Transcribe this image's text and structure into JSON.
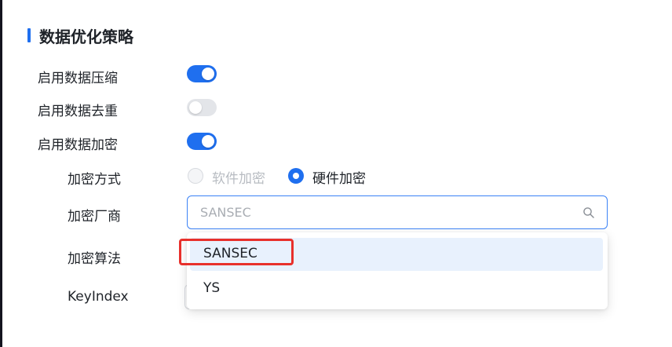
{
  "section": {
    "title": "数据优化策略"
  },
  "settings": {
    "compression": {
      "label": "启用数据压缩",
      "enabled": true
    },
    "dedup": {
      "label": "启用数据去重",
      "enabled": false
    },
    "encryption": {
      "label": "启用数据加密",
      "enabled": true
    }
  },
  "encryption": {
    "method_label": "加密方式",
    "methods": [
      {
        "label": "软件加密",
        "selected": false,
        "disabled": true
      },
      {
        "label": "硬件加密",
        "selected": true,
        "disabled": false
      }
    ],
    "vendor_label": "加密厂商",
    "vendor_value": "SANSEC",
    "algorithm_label": "加密算法",
    "keyindex_label": "KeyIndex"
  },
  "vendor_dropdown": {
    "options": [
      "SANSEC",
      "YS"
    ],
    "highlighted": "SANSEC"
  },
  "colors": {
    "accent": "#1f6fef",
    "annotation": "#e8302b"
  }
}
